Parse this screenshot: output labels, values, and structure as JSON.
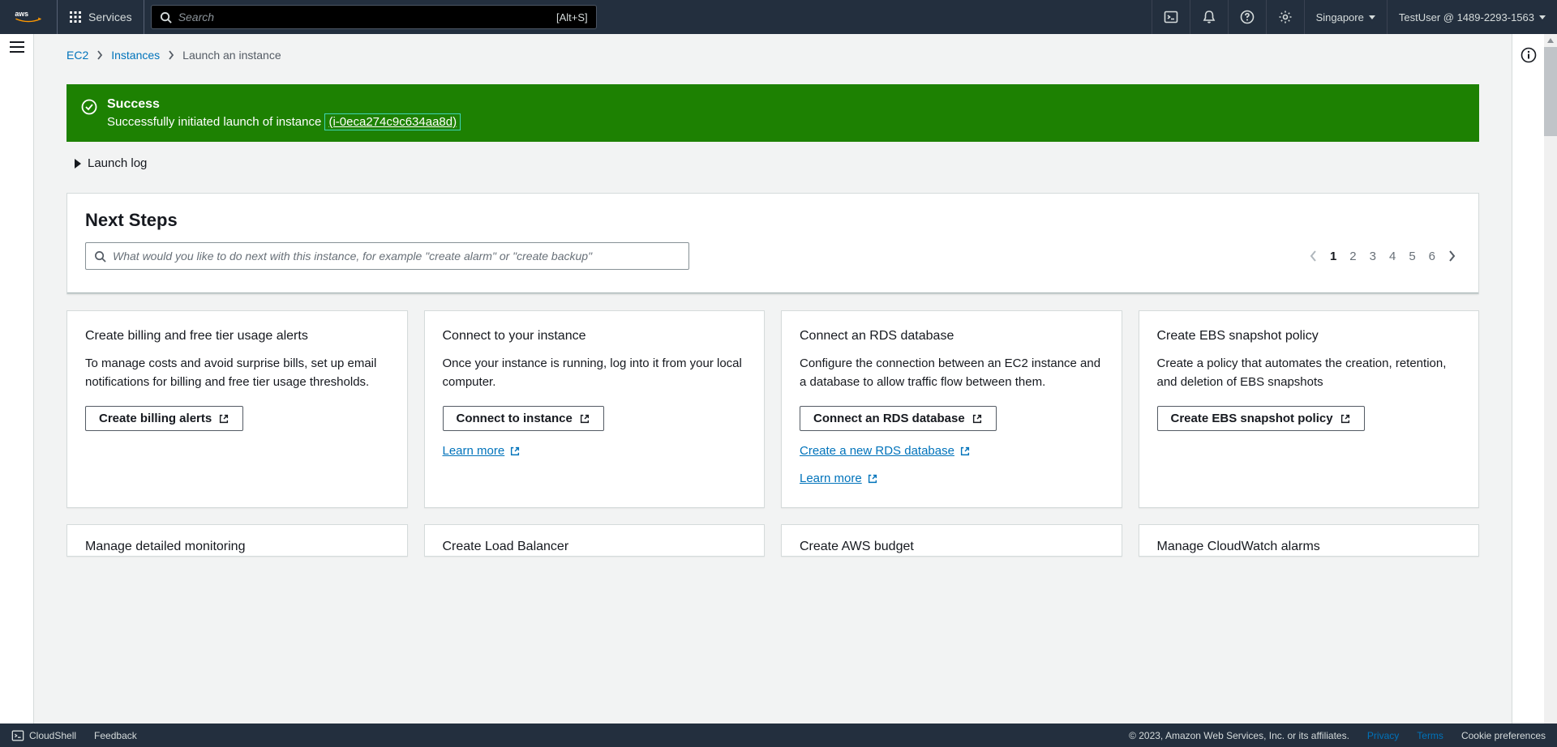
{
  "topnav": {
    "logo_text": "aws",
    "services_label": "Services",
    "search_placeholder": "Search",
    "search_shortcut": "[Alt+S]",
    "region": "Singapore",
    "user": "TestUser @ 1489-2293-1563"
  },
  "breadcrumbs": {
    "items": [
      "EC2",
      "Instances",
      "Launch an instance"
    ]
  },
  "banner": {
    "title": "Success",
    "message_prefix": "Successfully initiated launch of instance ",
    "instance_id": "(i-0eca274c9c634aa8d)"
  },
  "launch_log_label": "Launch log",
  "next_steps": {
    "heading": "Next Steps",
    "search_placeholder": "What would you like to do next with this instance, for example \"create alarm\" or \"create backup\"",
    "pages": [
      "1",
      "2",
      "3",
      "4",
      "5",
      "6"
    ],
    "active_page": "1"
  },
  "cards": [
    {
      "title": "Create billing and free tier usage alerts",
      "desc": "To manage costs and avoid surprise bills, set up email notifications for billing and free tier usage thresholds.",
      "button": "Create billing alerts",
      "links": []
    },
    {
      "title": "Connect to your instance",
      "desc": "Once your instance is running, log into it from your local computer.",
      "button": "Connect to instance",
      "links": [
        "Learn more"
      ]
    },
    {
      "title": "Connect an RDS database",
      "desc": "Configure the connection between an EC2 instance and a database to allow traffic flow between them.",
      "button": "Connect an RDS database",
      "links": [
        "Create a new RDS database",
        "Learn more"
      ]
    },
    {
      "title": "Create EBS snapshot policy",
      "desc": "Create a policy that automates the creation, retention, and deletion of EBS snapshots",
      "button": "Create EBS snapshot policy",
      "links": []
    }
  ],
  "cards_row2": [
    {
      "title": "Manage detailed monitoring"
    },
    {
      "title": "Create Load Balancer"
    },
    {
      "title": "Create AWS budget"
    },
    {
      "title": "Manage CloudWatch alarms"
    }
  ],
  "footer": {
    "cloudshell": "CloudShell",
    "feedback": "Feedback",
    "copyright": "© 2023, Amazon Web Services, Inc. or its affiliates.",
    "links": [
      "Privacy",
      "Terms",
      "Cookie preferences"
    ]
  }
}
